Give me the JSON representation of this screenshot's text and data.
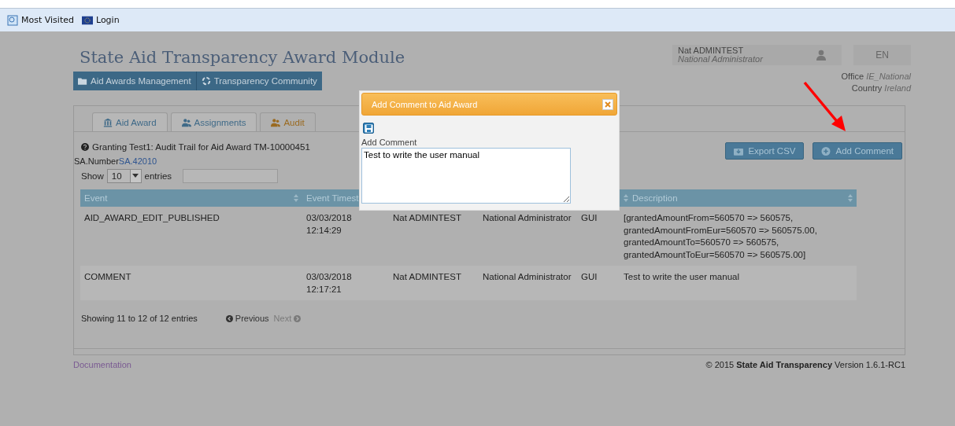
{
  "bookmarks": [
    {
      "label": "Most Visited"
    },
    {
      "label": "Login"
    }
  ],
  "app_title": "State Aid Transparency Award Module",
  "nav": [
    {
      "label": "Aid Awards Management"
    },
    {
      "label": "Transparency Community"
    }
  ],
  "user": {
    "name": "Nat ADMINTEST",
    "role": "National Administrator"
  },
  "language": "EN",
  "office": {
    "label": "Office",
    "value": "IE_National"
  },
  "country": {
    "label": "Country",
    "value": "Ireland"
  },
  "tabs": [
    {
      "label": "Aid Award",
      "selected": false
    },
    {
      "label": "Assignments",
      "selected": false
    },
    {
      "label": "Audit",
      "selected": true
    }
  ],
  "heading": "Granting Test1: Audit Trail for Aid Award TM-10000451",
  "sa_number": {
    "label": "SA.Number",
    "value": "SA.42010"
  },
  "page_size": {
    "prefix": "Show",
    "value": "10",
    "suffix": "entries"
  },
  "buttons": [
    {
      "label": "Export CSV"
    },
    {
      "label": "Add Comment"
    }
  ],
  "table": {
    "columns": [
      "Event",
      "Event Timest",
      "",
      "",
      "",
      "Description"
    ],
    "rows": [
      [
        "AID_AWARD_EDIT_PUBLISHED",
        "03/03/2018 12:14:29",
        "Nat ADMINTEST",
        "National Administrator",
        "GUI",
        "[grantedAmountFrom=560570 => 560575, grantedAmountFromEur=560570 => 560575.00, grantedAmountTo=560570 => 560575, grantedAmountToEur=560570 => 560575.00]"
      ],
      [
        "COMMENT",
        "03/03/2018 12:17:21",
        "Nat ADMINTEST",
        "National Administrator",
        "GUI",
        "Test to write the user manual"
      ]
    ]
  },
  "info": "Showing 11 to 12 of 12 entries",
  "pager": [
    {
      "label": "Previous",
      "disabled": false
    },
    {
      "label": "Next",
      "disabled": true
    }
  ],
  "footer": {
    "link": "Documentation",
    "copyright": "© 2015 **State Aid Transparency** Version 1.6.1-RC1"
  },
  "dialog": {
    "title": "Add Comment to Aid Award",
    "field_label": "Add Comment",
    "value": "Test to write the user manual"
  }
}
